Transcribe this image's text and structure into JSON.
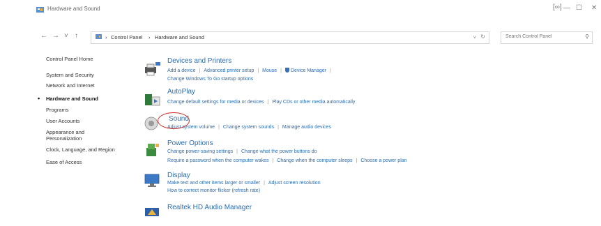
{
  "window": {
    "title": "Hardware and Sound",
    "minimize_glyph": "—",
    "maximize_glyph": "☐",
    "close_glyph": "✕",
    "extra_glyph": "[∞]"
  },
  "addressbar": {
    "back_glyph": "←",
    "forward_glyph": "→",
    "recent_glyph": "˅",
    "up_glyph": "↑",
    "crumbs": [
      "Control Panel",
      "Hardware and Sound"
    ],
    "crumb_sep": "›",
    "dropdown_glyph": "˅",
    "refresh_glyph": "↻",
    "search_placeholder": "Search Control Panel",
    "search_glyph": "⚲"
  },
  "sidebar": {
    "items": [
      {
        "label": "Control Panel Home"
      },
      {
        "label": "System and Security"
      },
      {
        "label": "Network and Internet"
      },
      {
        "label": "Hardware and Sound",
        "active": true
      },
      {
        "label": "Programs"
      },
      {
        "label": "User Accounts"
      },
      {
        "label": "Appearance and"
      },
      {
        "label": "Personalization"
      },
      {
        "label": "Clock, Language, and Region"
      },
      {
        "label": "Ease of Access"
      }
    ],
    "active_bullet": "•"
  },
  "categories": [
    {
      "key": "devices",
      "heading": "Devices and Printers",
      "rows": [
        [
          "Add a device",
          "Advanced printer setup",
          "Mouse",
          "Device Manager"
        ],
        [
          "Change Windows To Go startup options"
        ]
      ]
    },
    {
      "key": "autoplay",
      "heading": "AutoPlay",
      "rows": [
        [
          "Change default settings for media or devices",
          "Play CDs or other media automatically"
        ]
      ]
    },
    {
      "key": "sound",
      "heading": "Sound",
      "rows": [
        [
          "Adjust system volume",
          "Change system sounds",
          "Manage audio devices"
        ]
      ]
    },
    {
      "key": "power",
      "heading": "Power Options",
      "rows": [
        [
          "Change power-saving settings",
          "Change what the power buttons do"
        ],
        [
          "Require a password when the computer wakes",
          "Change when the computer sleeps",
          "Choose a power plan"
        ]
      ]
    },
    {
      "key": "display",
      "heading": "Display",
      "rows": [
        [
          "Make text and other items larger or smaller",
          "Adjust screen resolution"
        ],
        [
          "How to correct monitor flicker (refresh rate)"
        ]
      ]
    },
    {
      "key": "realtek",
      "heading": "Realtek HD Audio Manager",
      "rows": []
    }
  ],
  "link_separator": "|",
  "colors": {
    "link": "#2a6db3",
    "annotation_circle": "#c7332e"
  },
  "icons": {
    "devices": "printer-icon",
    "autoplay": "autoplay-icon",
    "sound": "speaker-icon",
    "power": "power-options-icon",
    "display": "monitor-icon",
    "realtek": "realtek-audio-icon"
  }
}
